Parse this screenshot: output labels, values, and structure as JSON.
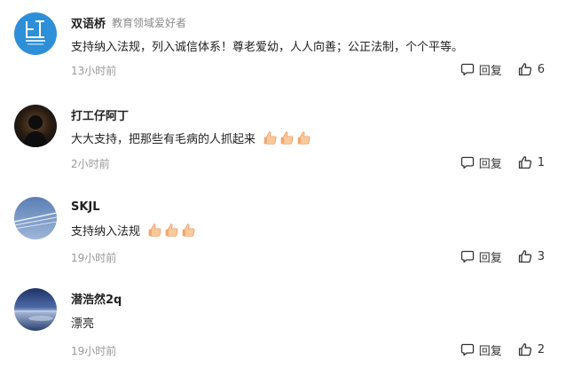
{
  "comments": [
    {
      "author": "双语桥",
      "tag": "教育领域爱好者",
      "avatar_icon": "blue-square-logo-avatar",
      "text": "支持纳入法规，列入诚信体系！尊老爱幼，人人向善；公正法制，个个平等。",
      "emojis": [],
      "time": "13小时前",
      "reply_label": "回复",
      "likes": "6"
    },
    {
      "author": "打工仔阿丁",
      "tag": "",
      "avatar_icon": "dark-silhouette-avatar",
      "text": "大大支持，把那些有毛病的人抓起来",
      "emojis": [
        "thumbs-up-emoji",
        "thumbs-up-emoji",
        "thumbs-up-emoji"
      ],
      "time": "2小时前",
      "reply_label": "回复",
      "likes": "1"
    },
    {
      "author": "SKJL",
      "tag": "",
      "avatar_icon": "blue-sky-avatar",
      "text": "支持纳入法规",
      "emojis": [
        "thumbs-up-emoji",
        "thumbs-up-emoji",
        "thumbs-up-emoji"
      ],
      "time": "19小时前",
      "reply_label": "回复",
      "likes": "3"
    },
    {
      "author": "潜浩然2q",
      "tag": "",
      "avatar_icon": "sea-horizon-avatar",
      "text": "漂亮",
      "emojis": [],
      "time": "19小时前",
      "reply_label": "回复",
      "likes": "2"
    }
  ],
  "colors": {
    "name": "#222222",
    "meta": "#999999",
    "logo_bg": "#2d8fd8"
  }
}
